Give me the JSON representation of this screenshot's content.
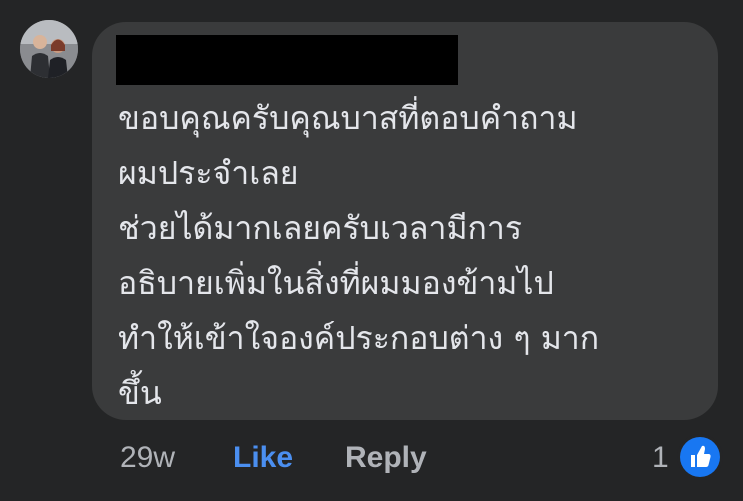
{
  "comment": {
    "lines": [
      "ขอบคุณครับคุณบาสที่ตอบคำถาม",
      "ผมประจำเลย",
      "ช่วยได้มากเลยครับเวลามีการ",
      "อธิบายเพิ่มในสิ่งที่ผมมองข้ามไป",
      "ทำให้เข้าใจองค์ประกอบต่าง ๆ มาก",
      "ขึ้น"
    ]
  },
  "actions": {
    "timestamp": "29w",
    "like_label": "Like",
    "reply_label": "Reply"
  },
  "reactions": {
    "count": "1",
    "icon": "thumbs-up-icon"
  },
  "colors": {
    "background": "#242526",
    "bubble": "#3a3b3c",
    "text": "#e4e6eb",
    "like_action": "#4b8ff0",
    "muted": "#b0b3b8",
    "reaction_blue": "#1877f2"
  }
}
